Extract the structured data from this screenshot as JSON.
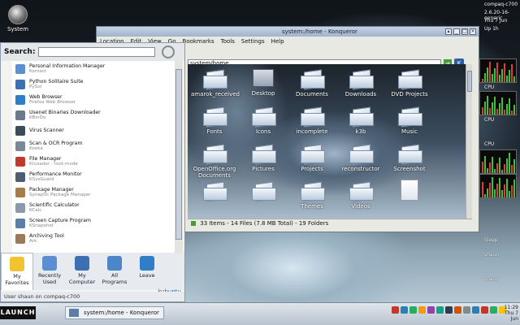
{
  "desktop": {
    "system_icon_label": "System"
  },
  "konqueror": {
    "title": "system:/home - Konqueror",
    "menu": [
      "Location",
      "Edit",
      "View",
      "Go",
      "Bookmarks",
      "Tools",
      "Settings",
      "Help"
    ],
    "location": "system/home",
    "status": "33 Items - 14 Files (7.8 MB Total) - 19 Folders",
    "items": [
      {
        "name": "amarok_received",
        "kind": "folder"
      },
      {
        "name": "Desktop",
        "kind": "desktop"
      },
      {
        "name": "Documents",
        "kind": "folder"
      },
      {
        "name": "Downloads",
        "kind": "folder"
      },
      {
        "name": "DVD Projects",
        "kind": "folder"
      },
      {
        "name": "Fonts",
        "kind": "folder"
      },
      {
        "name": "Icons",
        "kind": "folder"
      },
      {
        "name": "incomplete",
        "kind": "folder"
      },
      {
        "name": "k3b",
        "kind": "folder"
      },
      {
        "name": "Music",
        "kind": "folder"
      },
      {
        "name": "OpenOffice.org Documents",
        "kind": "folder"
      },
      {
        "name": "Pictures",
        "kind": "folder"
      },
      {
        "name": "Projects",
        "kind": "folder"
      },
      {
        "name": "reconstructor",
        "kind": "folder"
      },
      {
        "name": "Screenshot",
        "kind": "folder"
      },
      {
        "name": "",
        "kind": "folder"
      },
      {
        "name": "",
        "kind": "folder"
      },
      {
        "name": "Themes",
        "kind": "folder"
      },
      {
        "name": "Videos",
        "kind": "folder"
      },
      {
        "name": "",
        "kind": "file"
      }
    ]
  },
  "kickoff": {
    "search_label": "Search:",
    "search_value": "",
    "apps": [
      {
        "name": "Personal Information Manager",
        "desc": "Kontact",
        "color": "#5b8fd1"
      },
      {
        "name": "Python Solitaire Suite",
        "desc": "PySol",
        "color": "#3d6fb5"
      },
      {
        "name": "Web Browser",
        "desc": "Firefox Web Browser",
        "color": "#2f7fc8"
      },
      {
        "name": "Usenet Binaries Downloader",
        "desc": "KBinDo",
        "color": "#6a7a8c"
      },
      {
        "name": "Virus Scanner",
        "desc": "",
        "color": "#3c4a5a"
      },
      {
        "name": "Scan & OCR Program",
        "desc": "Kooka",
        "color": "#7a8898"
      },
      {
        "name": "File Manager",
        "desc": "Krusader - root-mode",
        "color": "#c23a2a"
      },
      {
        "name": "Performance Monitor",
        "desc": "KSysGuard",
        "color": "#4e5e70"
      },
      {
        "name": "Package Manager",
        "desc": "Synaptic Package Manager",
        "color": "#a87b4a"
      },
      {
        "name": "Scientific Calculator",
        "desc": "KCalc",
        "color": "#8a9aaa"
      },
      {
        "name": "Screen Capture Program",
        "desc": "KSnapshot",
        "color": "#5a7fa8"
      },
      {
        "name": "Archiving Tool",
        "desc": "Ark",
        "color": "#9a7a5a"
      }
    ],
    "tabs": [
      {
        "label": "My Favorites",
        "icon": "star-icon",
        "color": "#f1c232"
      },
      {
        "label": "Recently Used",
        "icon": "clock-icon",
        "color": "#5b8fd1"
      },
      {
        "label": "My Computer",
        "icon": "computer-icon",
        "color": "#3d6fb5"
      },
      {
        "label": "All Programs",
        "icon": "grid-icon",
        "color": "#4a86c8"
      },
      {
        "label": "Leave",
        "icon": "leave-icon",
        "color": "#2f7fc8"
      }
    ],
    "brand": "kubuntu",
    "user_line": "User shaun on compaq-c700"
  },
  "monitors": {
    "lines": [
      "compaq-c700",
      "2.6.20-16-generic",
      "Thu 7 Jun",
      "Up 1h",
      "CPU",
      "CPU",
      "CPU",
      "shaun",
      "Sleep",
      "shaun"
    ]
  },
  "taskbar": {
    "launch_label": "LAUNCH",
    "window_label": "system:/home - Konqueror",
    "tray_colors": [
      "#c0392b",
      "#2980b9",
      "#27ae60",
      "#f39c12",
      "#8e44ad",
      "#16a085",
      "#2c3e50",
      "#d35400",
      "#7f8c8d",
      "#2980b9",
      "#c0392b",
      "#27ae60",
      "#f1c40f"
    ],
    "clock_line1": "11:29",
    "clock_line2": "Thu 7 Jun"
  }
}
